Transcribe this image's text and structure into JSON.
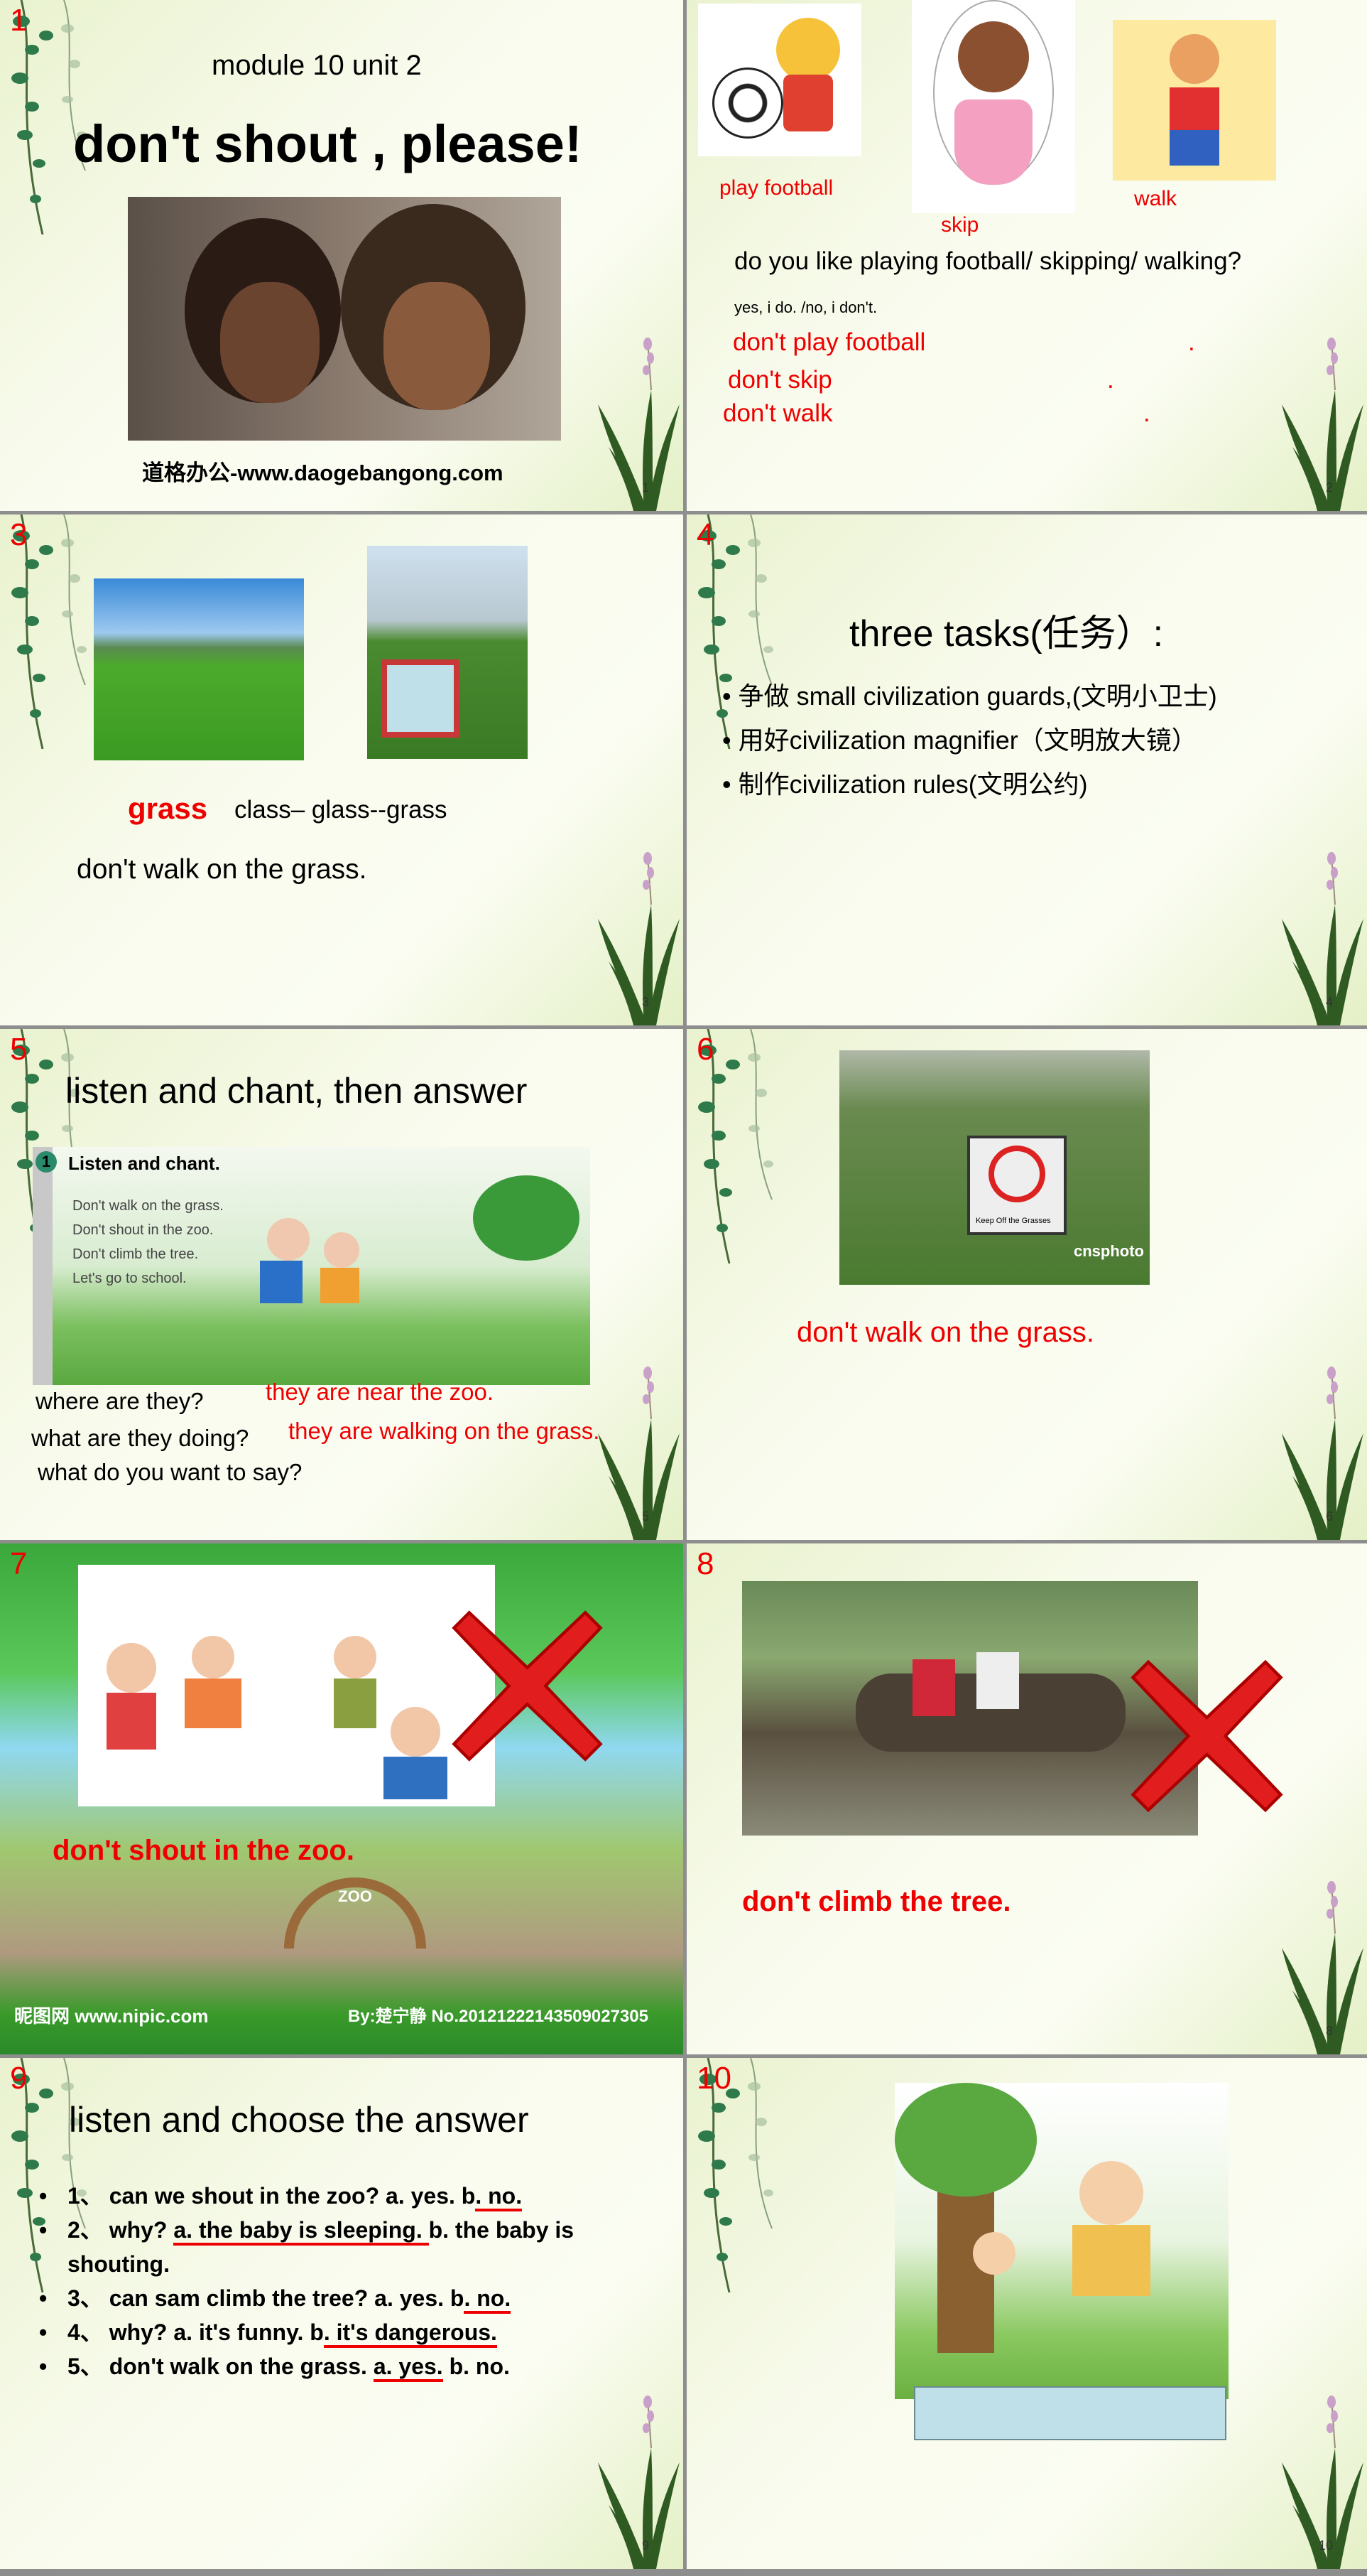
{
  "colors": {
    "accent_red": "#e00000",
    "answer_box": "#bfe0e8"
  },
  "slides": [
    {
      "number": "1",
      "page": "1",
      "subtitle": "module 10 unit 2",
      "title": "don't  shout , please!",
      "caption": "道格办公-www.daogebangong.com"
    },
    {
      "number": "2",
      "page": "2",
      "labels": [
        "play football",
        "skip",
        "walk"
      ],
      "question": "do you like playing  football/ skipping/ walking?",
      "answer": "yes, i do. /no, i don't.",
      "lines": [
        "don't play football",
        "don't skip",
        "don't walk"
      ],
      "dot": "."
    },
    {
      "number": "3",
      "page": "3",
      "word": "grass",
      "chain": "class– glass--grass",
      "sentence": "don't walk on the grass."
    },
    {
      "number": "4",
      "page": "4",
      "title": "three tasks(任务）:",
      "items": [
        "争做 small civilization guards,(文明小卫士)",
        "用好civilization magnifier（文明放大镜）",
        "制作civilization rules(文明公约)"
      ]
    },
    {
      "number": "5",
      "page": "5",
      "title": "listen and chant,  then answer",
      "book_heading": "Listen and chant.",
      "book_num": "1",
      "chant": [
        "Don't walk on the grass.",
        "Don't shout in the zoo.",
        "Don't climb the tree.",
        "Let's go to school."
      ],
      "questions": [
        "where are they?",
        "what are they doing?",
        "what do you want to say?"
      ],
      "answers": [
        "they are near the zoo.",
        "they are walking  on the grass."
      ]
    },
    {
      "number": "6",
      "page": "6",
      "photo_text": "cnsphoto",
      "sign_text": "Keep Off the Grasses",
      "sentence": "don't walk on the grass."
    },
    {
      "number": "7",
      "sentence": "don't shout in the zoo.",
      "gate_text": "ZOO",
      "watermark_left": "昵图网 www.nipic.com",
      "watermark_right": "By:楚宁静 No.20121222143509027305"
    },
    {
      "number": "8",
      "page": "8",
      "sentence": "don't climb the tree."
    },
    {
      "number": "9",
      "page": "9",
      "title": "listen and choose the answer",
      "items": [
        {
          "pre": "1、 can we shout in the zoo? a. yes. b",
          "ans": ". no. ",
          "post": ""
        },
        {
          "pre": "2、 why? ",
          "ans": "a. the baby is sleeping. ",
          "post": "b. the baby is shouting."
        },
        {
          "pre": "3、 can sam climb the tree? a. yes. b",
          "ans": ". no. ",
          "post": ""
        },
        {
          "pre": "4、 why? a. it's funny. b",
          "ans": ". it's dangerous.",
          "post": ""
        },
        {
          "pre": "5、 don't walk on the grass. ",
          "ans": "a. yes.",
          "post": " b. no."
        }
      ]
    },
    {
      "number": "10",
      "page": "10"
    }
  ]
}
